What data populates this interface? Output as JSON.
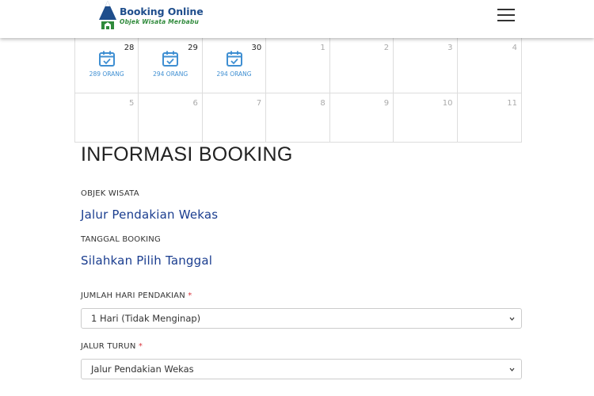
{
  "header": {
    "logo_title": "Booking Online",
    "logo_subtitle": "Objek Wisata Merbabu"
  },
  "calendar": {
    "rows": [
      [
        {
          "day": "28",
          "active": true,
          "count": "289 ORANG"
        },
        {
          "day": "29",
          "active": true,
          "count": "294 ORANG"
        },
        {
          "day": "30",
          "active": true,
          "count": "294 ORANG"
        },
        {
          "day": "1",
          "active": false
        },
        {
          "day": "2",
          "active": false
        },
        {
          "day": "3",
          "active": false
        },
        {
          "day": "4",
          "active": false
        }
      ],
      [
        {
          "day": "5",
          "active": false
        },
        {
          "day": "6",
          "active": false
        },
        {
          "day": "7",
          "active": false
        },
        {
          "day": "8",
          "active": false
        },
        {
          "day": "9",
          "active": false
        },
        {
          "day": "10",
          "active": false
        },
        {
          "day": "11",
          "active": false
        }
      ]
    ]
  },
  "info": {
    "title": "INFORMASI BOOKING",
    "objek_label": "OBJEK WISATA",
    "objek_value": "Jalur Pendakian Wekas",
    "tanggal_label": "TANGGAL BOOKING",
    "tanggal_value": "Silahkan Pilih Tanggal",
    "jumlah_label": "JUMLAH HARI PENDAKIAN",
    "jumlah_selected": "1 Hari (Tidak Menginap)",
    "turun_label": "JALUR TURUN",
    "turun_selected": "Jalur Pendakian Wekas",
    "required_mark": "*"
  },
  "colors": {
    "brand_blue": "#1f4e8c",
    "brand_green": "#2f8a3b",
    "calendar_accent": "#3f8fd2",
    "value_text": "#1a3d8f",
    "required": "#d9363e"
  }
}
